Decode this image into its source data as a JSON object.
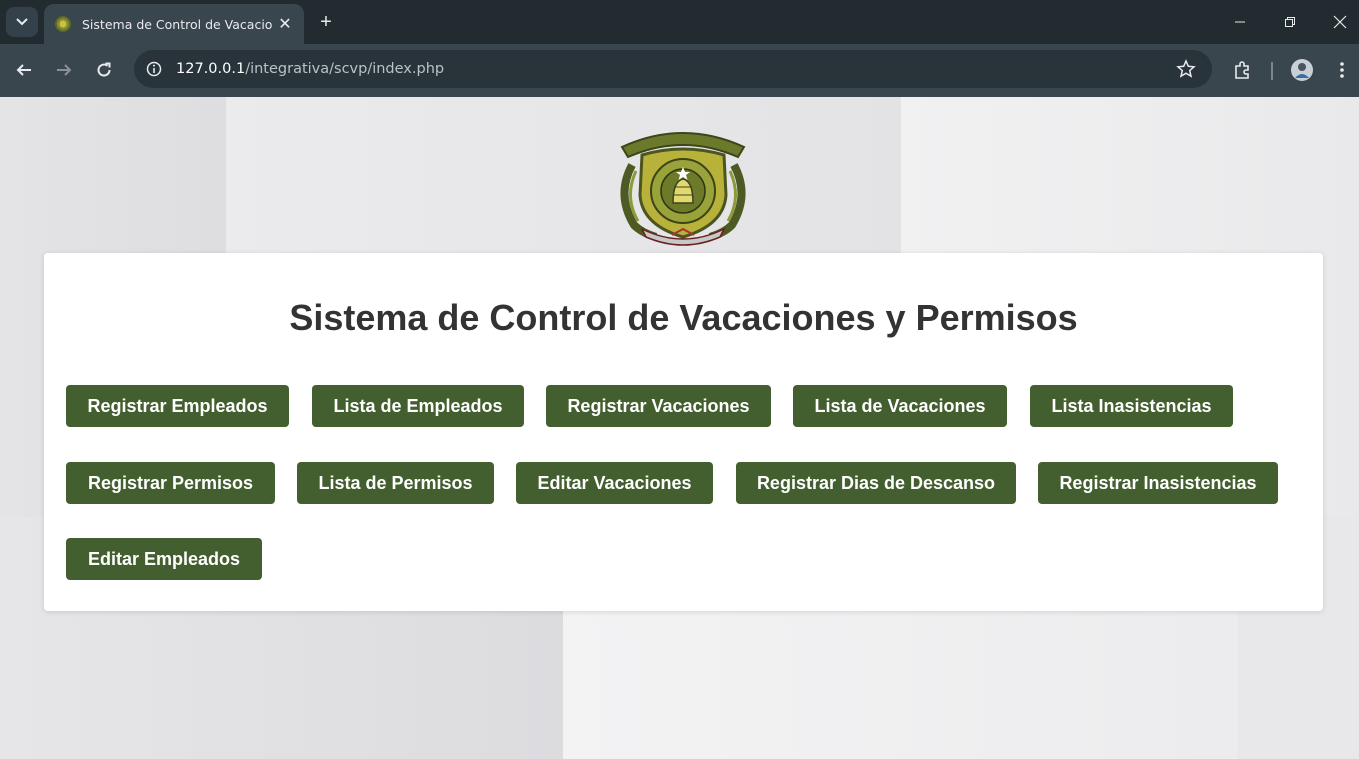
{
  "browser": {
    "tab_title": "Sistema de Control de Vacaciones y Permisos",
    "url_host": "127.0.0.1",
    "url_path": "/integrativa/scvp/index.php",
    "icons": [
      "tab-search-icon",
      "favicon-icon",
      "close-icon",
      "plus-icon",
      "minimize-icon",
      "restore-icon",
      "window-close-icon",
      "back-icon",
      "forward-icon",
      "reload-icon",
      "info-icon",
      "star-icon",
      "extensions-icon",
      "profile-avatar",
      "menu-icon"
    ]
  },
  "page": {
    "title": "Sistema de Control de Vacaciones y Permisos",
    "button_color": "#435f2f",
    "buttons": [
      "Registrar Empleados",
      "Lista de Empleados",
      "Registrar Vacaciones",
      "Lista de Vacaciones",
      "Lista Inasistencias",
      "Registrar Permisos",
      "Lista de Permisos",
      "Editar Vacaciones",
      "Registrar Dias de Descanso",
      "Registrar Inasistencias",
      "Editar Empleados"
    ]
  }
}
